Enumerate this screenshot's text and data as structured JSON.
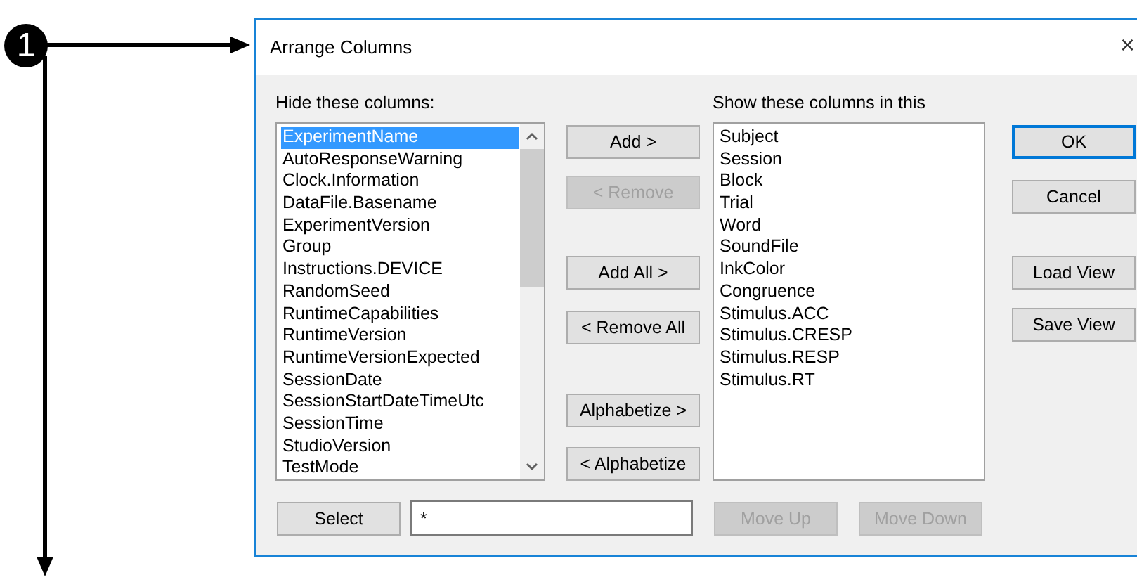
{
  "annotation": {
    "badge": "1"
  },
  "dialog": {
    "title": "Arrange Columns",
    "close": "×"
  },
  "hidden_columns": {
    "label": "Hide these columns:",
    "items": [
      {
        "text": "ExperimentName",
        "selected": true
      },
      {
        "text": "AutoResponseWarning",
        "selected": false
      },
      {
        "text": "Clock.Information",
        "selected": false
      },
      {
        "text": "DataFile.Basename",
        "selected": false
      },
      {
        "text": "ExperimentVersion",
        "selected": false
      },
      {
        "text": "Group",
        "selected": false
      },
      {
        "text": "Instructions.DEVICE",
        "selected": false
      },
      {
        "text": "RandomSeed",
        "selected": false
      },
      {
        "text": "RuntimeCapabilities",
        "selected": false
      },
      {
        "text": "RuntimeVersion",
        "selected": false
      },
      {
        "text": "RuntimeVersionExpected",
        "selected": false
      },
      {
        "text": "SessionDate",
        "selected": false
      },
      {
        "text": "SessionStartDateTimeUtc",
        "selected": false
      },
      {
        "text": "SessionTime",
        "selected": false
      },
      {
        "text": "StudioVersion",
        "selected": false
      },
      {
        "text": "TestMode",
        "selected": false
      }
    ]
  },
  "middle_buttons": [
    {
      "label": "Add >",
      "disabled": false
    },
    {
      "label": "< Remove",
      "disabled": true
    },
    {
      "label": "Add All >",
      "disabled": false
    },
    {
      "label": "< Remove All",
      "disabled": false
    },
    {
      "label": "Alphabetize >",
      "disabled": false
    },
    {
      "label": "< Alphabetize",
      "disabled": false
    }
  ],
  "shown_columns": {
    "label": "Show these columns in this",
    "items": [
      {
        "text": "Subject",
        "selected": false
      },
      {
        "text": "Session",
        "selected": false
      },
      {
        "text": "Block",
        "selected": false
      },
      {
        "text": "Trial",
        "selected": false
      },
      {
        "text": "Word",
        "selected": false
      },
      {
        "text": "SoundFile",
        "selected": false
      },
      {
        "text": "InkColor",
        "selected": false
      },
      {
        "text": "Congruence",
        "selected": false
      },
      {
        "text": "Stimulus.ACC",
        "selected": false
      },
      {
        "text": "Stimulus.CRESP",
        "selected": false
      },
      {
        "text": "Stimulus.RESP",
        "selected": false
      },
      {
        "text": "Stimulus.RT",
        "selected": false
      }
    ]
  },
  "side_buttons": [
    {
      "label": "OK",
      "default": true
    },
    {
      "label": "Cancel",
      "default": false
    },
    {
      "label": "Load View",
      "default": false
    },
    {
      "label": "Save View",
      "default": false
    }
  ],
  "select_button": {
    "label": "Select"
  },
  "filter_field": {
    "value": "*"
  },
  "move_buttons": [
    {
      "label": "Move Up",
      "disabled": true
    },
    {
      "label": "Move Down",
      "disabled": true
    }
  ]
}
